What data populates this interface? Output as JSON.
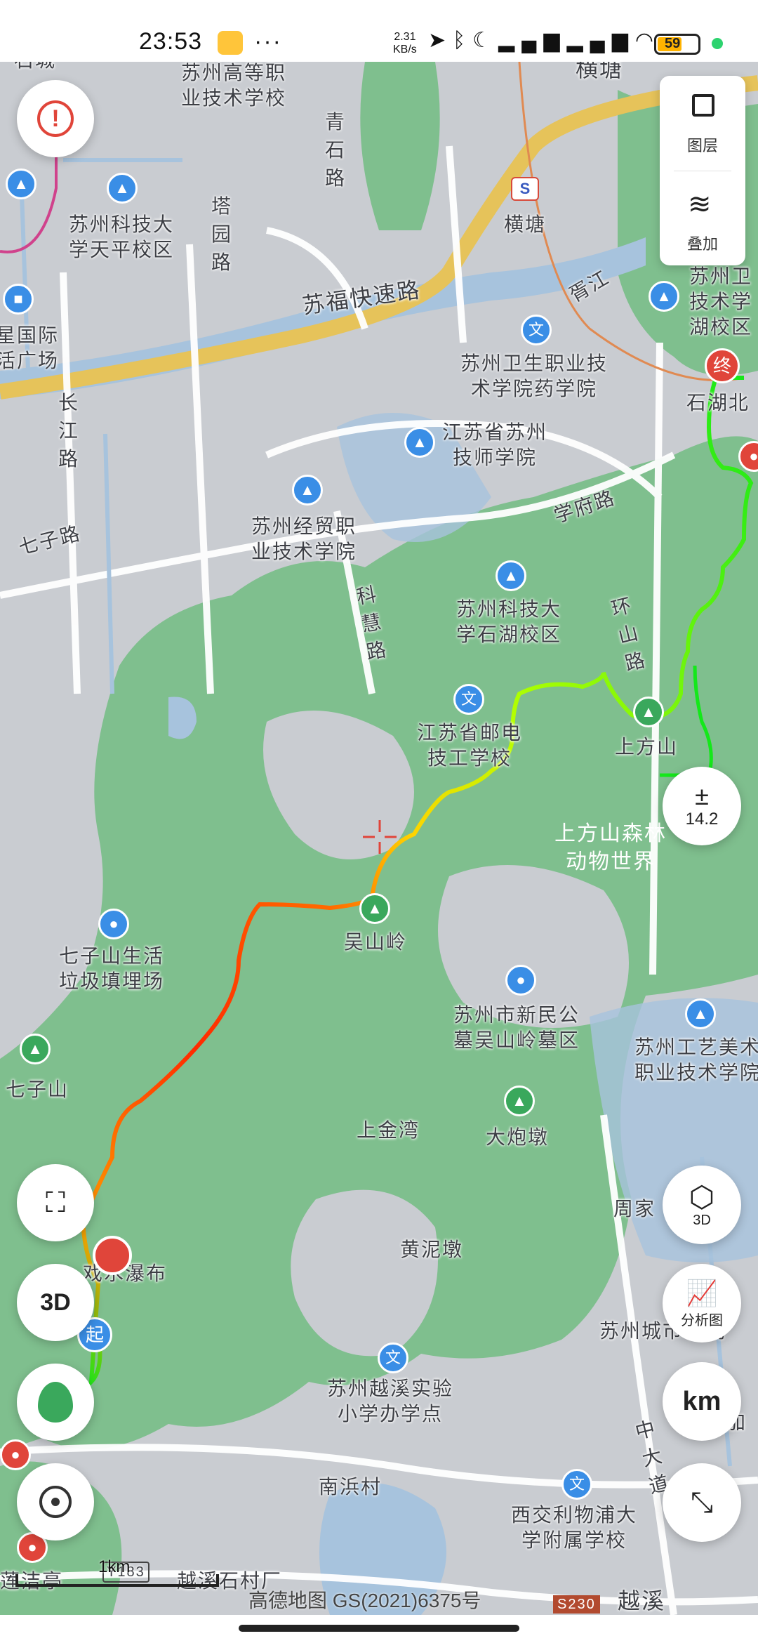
{
  "status_bar": {
    "time": "23:53",
    "more": "···",
    "net_speed_value": "2.31",
    "net_speed_unit": "KB/s",
    "battery": "59"
  },
  "map": {
    "labels": {
      "shicheng": "石城",
      "gaodeng": "苏州高等职\n业技术学校",
      "hengtang_top": "横塘",
      "qingshilu": "青\n石\n路",
      "keji_tianping": "苏州科技大\n学天平校区",
      "taoyuanlu": "塔\n园\n路",
      "hengtang_metro": "横塘",
      "sufu": "苏福快速路",
      "xujiang": "胥江",
      "guoji": "星国际\n活广场",
      "keji_right": "苏州卫\n技术学\n湖校区",
      "weisheng": "苏州卫生职业技\n术学院药学院",
      "shihubei": "石湖北",
      "changjiang": "长\n江\n路",
      "jishi": "江苏省苏州\n技师学院",
      "qizilu": "七子路",
      "jingmao": "苏州经贸职\n业技术学院",
      "xuefu": "学府路",
      "kehui": "科\n慧\n路",
      "keji_shihu": "苏州科技大\n学石湖校区",
      "huanshan": "环\n山\n路",
      "youdian": "江苏省邮电\n技工学校",
      "shangfang": "上方山",
      "dongwu": "上方山森林\n动物世界",
      "wushanling": "吴山岭",
      "qizishan_laji": "七子山生活\n垃圾填埋场",
      "muqu": "苏州市新民公\n墓吴山岭墓区",
      "gongyi": "苏州工艺美术\n职业技术学院",
      "qizishan": "七子山",
      "shangjinwan": "上金湾",
      "dapaodun": "大炮墩",
      "pubu": "戏水瀑布",
      "zhoujia": "周家",
      "huangnidun": "黄泥墩",
      "yuexi_xiaoxue": "苏州越溪实验\n小学办学点",
      "chengshi": "苏州城市学院",
      "nanbin": "南浜村",
      "xijiao": "西交利物浦大\n学附属学校",
      "jinhe": "锦和加",
      "yuexi_shicun": "越溪石村厂",
      "lianjie": "莲洁亭",
      "y183": "Y183",
      "s230": "S230",
      "yuexi": "越溪",
      "da_dao": "中\n大\n道",
      "end_marker": "终",
      "start_marker": "起"
    },
    "scale_label": "1km",
    "copyright": "高德地图 GS(2021)6375号"
  },
  "controls": {
    "alert_icon": "!",
    "layers_label": "图层",
    "overlay_label": "叠加",
    "zoom_value": "14.2",
    "zoom_symbol": "±",
    "btn_3d_label": "3D",
    "analysis_label": "分析图",
    "km_label": "km",
    "left_3d_label": "3D"
  },
  "colors": {
    "map_green": "#7fbf8e",
    "map_base": "#c9ccd1",
    "water": "#a7c3dd",
    "road_yellow": "#e6c35a",
    "track_start": "#14e81a",
    "track_mid": "#ffd400",
    "track_hot": "#ff2a00",
    "accent_blue": "#3a8ee6"
  }
}
